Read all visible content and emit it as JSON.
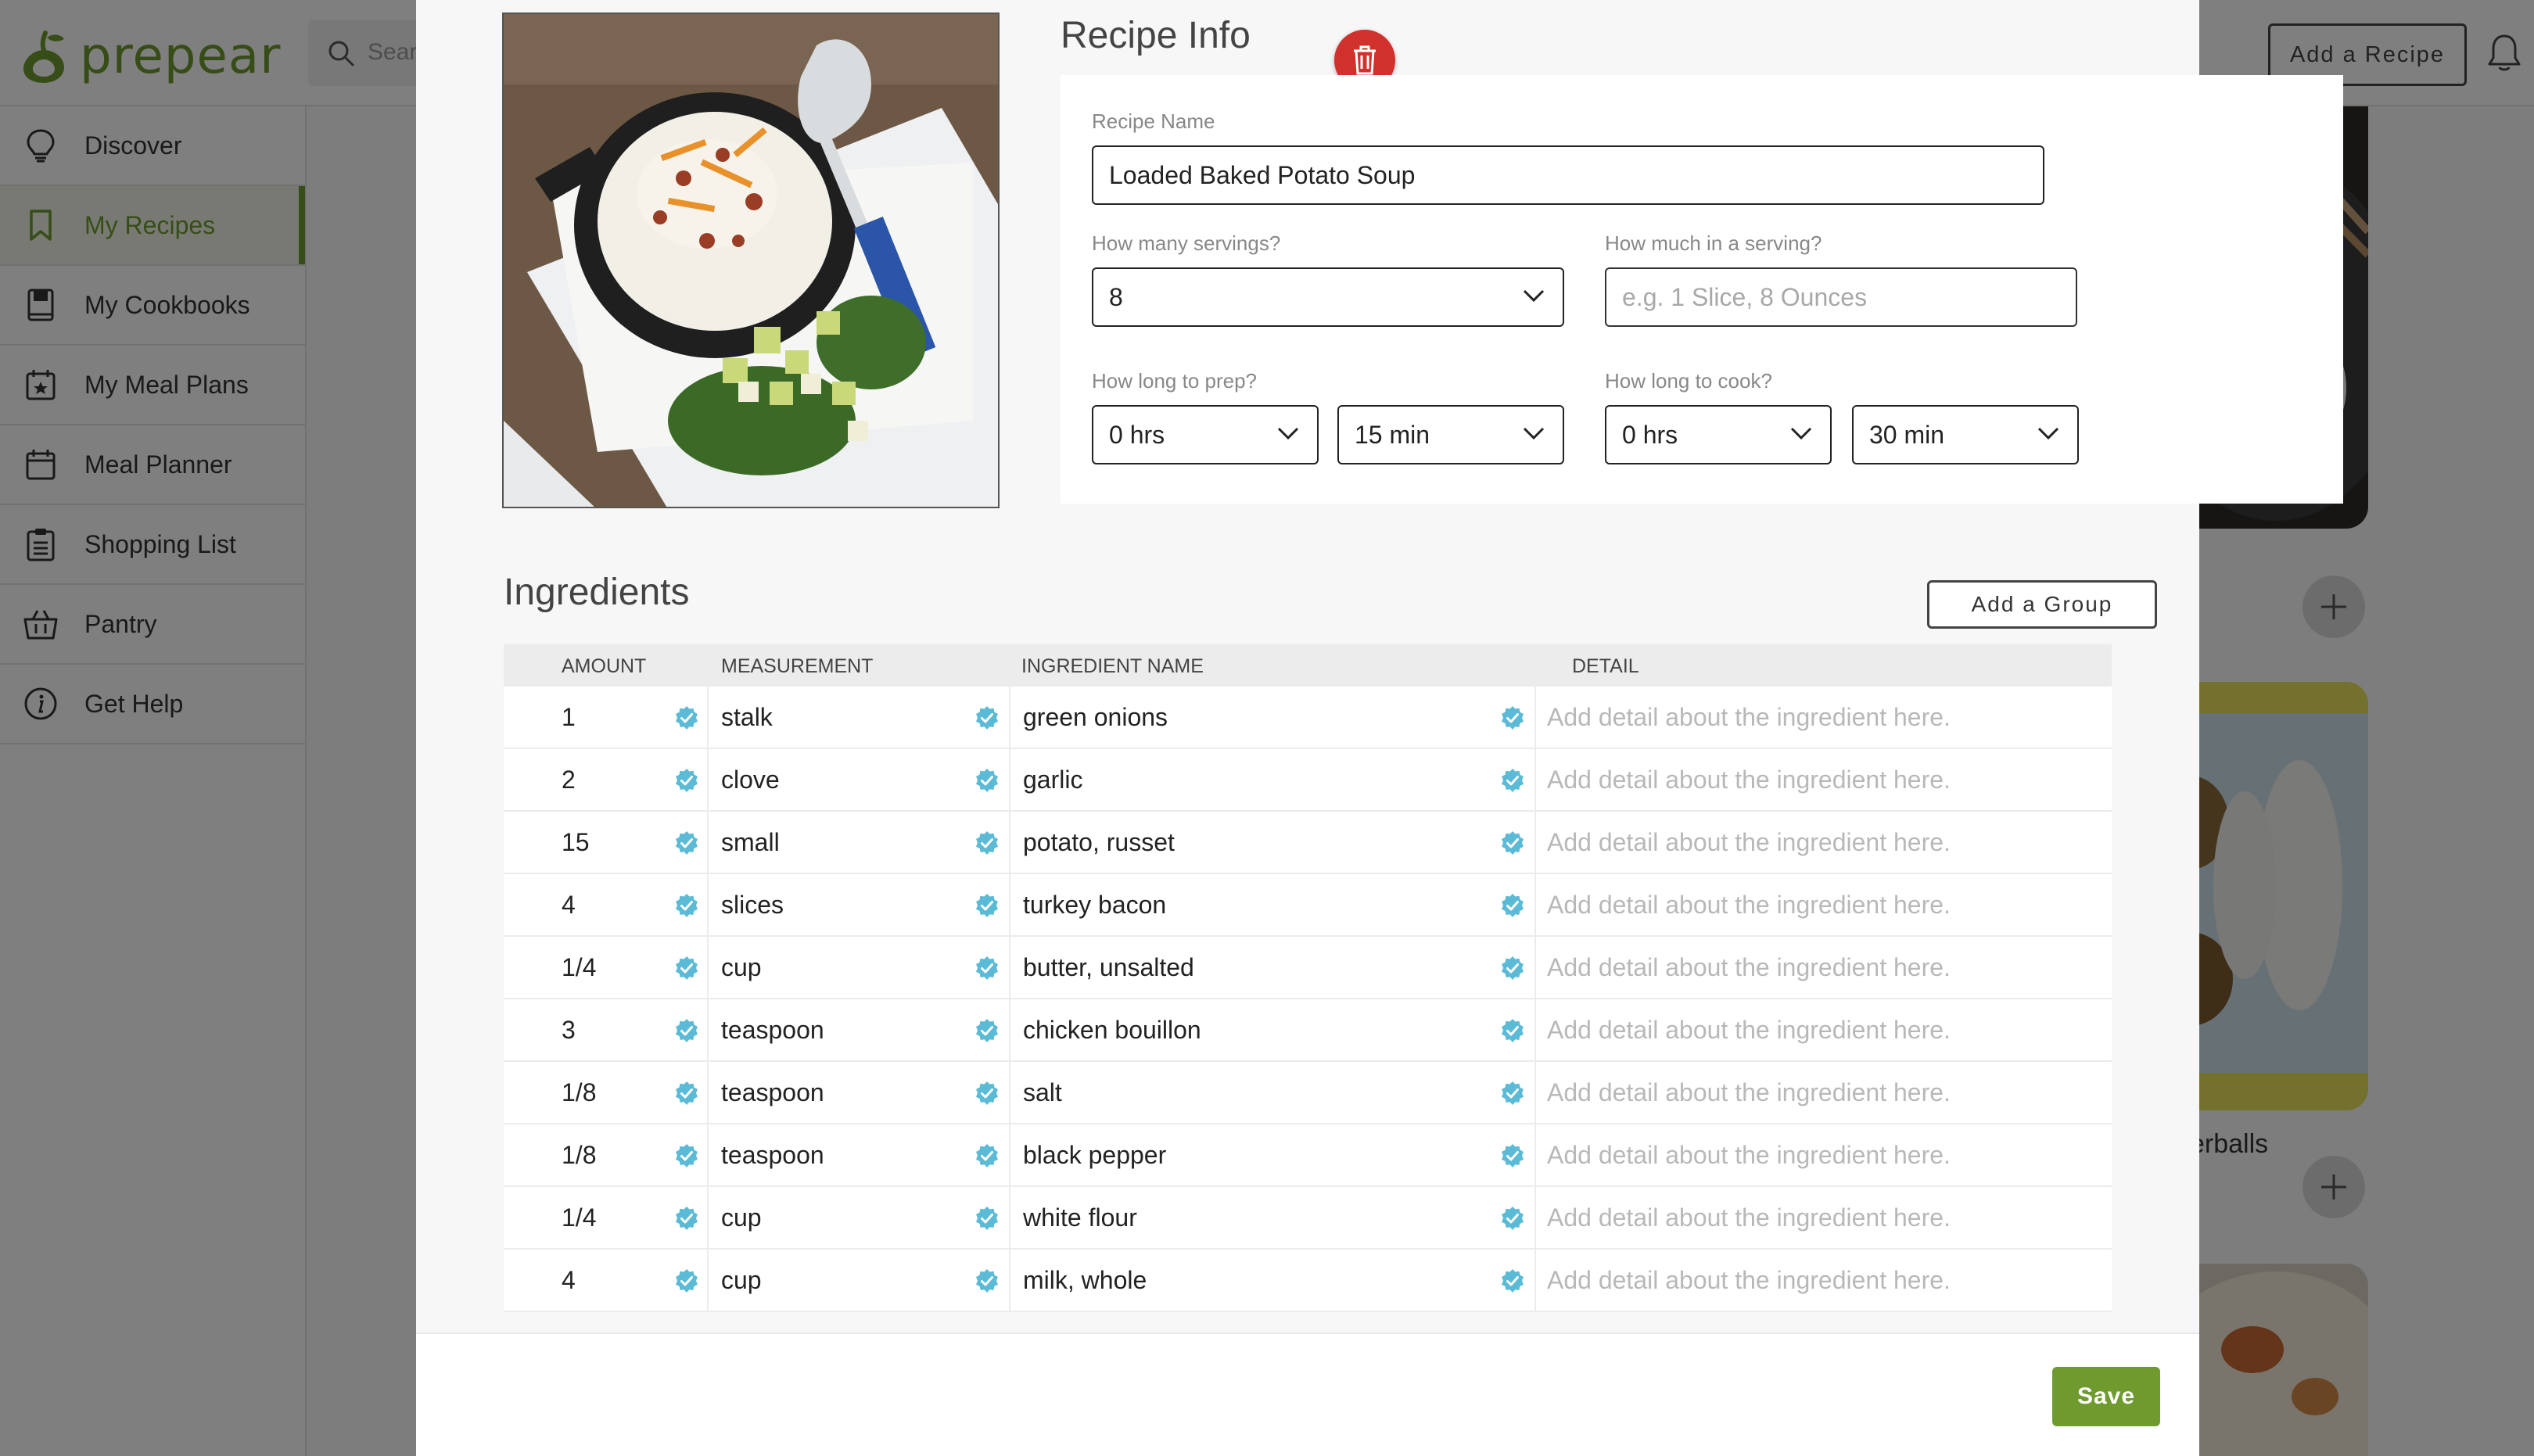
{
  "app": {
    "logo_text": "prepear",
    "search_placeholder": "Search",
    "add_recipe_label": "Add a Recipe",
    "partial_card_title": "erballs"
  },
  "sidebar": {
    "items": [
      {
        "label": "Discover",
        "icon": "lightbulb-icon"
      },
      {
        "label": "My Recipes",
        "icon": "bookmark-icon",
        "active": true
      },
      {
        "label": "My Cookbooks",
        "icon": "book-icon"
      },
      {
        "label": "My Meal Plans",
        "icon": "calendar-star-icon"
      },
      {
        "label": "Meal Planner",
        "icon": "calendar-icon"
      },
      {
        "label": "Shopping List",
        "icon": "clipboard-icon"
      },
      {
        "label": "Pantry",
        "icon": "basket-icon"
      },
      {
        "label": "Get Help",
        "icon": "info-icon"
      }
    ]
  },
  "recipe_info": {
    "title": "Recipe Info",
    "name_label": "Recipe Name",
    "name_value": "Loaded Baked Potato Soup",
    "servings_label": "How many servings?",
    "servings_value": "8",
    "serving_size_label": "How much in a serving?",
    "serving_size_placeholder": "e.g. 1 Slice, 8 Ounces",
    "prep_label": "How long to prep?",
    "prep_hrs": "0 hrs",
    "prep_min": "15 min",
    "cook_label": "How long to cook?",
    "cook_hrs": "0 hrs",
    "cook_min": "30 min"
  },
  "ingredients": {
    "title": "Ingredients",
    "add_group_label": "Add a Group",
    "headers": {
      "amount": "AMOUNT",
      "measurement": "MEASUREMENT",
      "name": "INGREDIENT NAME",
      "detail": "DETAIL"
    },
    "detail_placeholder": "Add detail about the ingredient here.",
    "rows": [
      {
        "amount": "1",
        "measurement": "stalk",
        "name": "green onions"
      },
      {
        "amount": "2",
        "measurement": "clove",
        "name": "garlic"
      },
      {
        "amount": "15",
        "measurement": "small",
        "name": "potato, russet"
      },
      {
        "amount": "4",
        "measurement": "slices",
        "name": "turkey bacon"
      },
      {
        "amount": "1/4",
        "measurement": "cup",
        "name": "butter, unsalted"
      },
      {
        "amount": "3",
        "measurement": "teaspoon",
        "name": "chicken bouillon"
      },
      {
        "amount": "1/8",
        "measurement": "teaspoon",
        "name": "salt"
      },
      {
        "amount": "1/8",
        "measurement": "teaspoon",
        "name": "black pepper"
      },
      {
        "amount": "1/4",
        "measurement": "cup",
        "name": "white flour"
      },
      {
        "amount": "4",
        "measurement": "cup",
        "name": "milk, whole"
      }
    ]
  },
  "footer": {
    "save_label": "Save"
  },
  "colors": {
    "brand_green": "#6e9a2e",
    "check_blue": "#5bbbd6",
    "delete_red": "#d0312d"
  }
}
